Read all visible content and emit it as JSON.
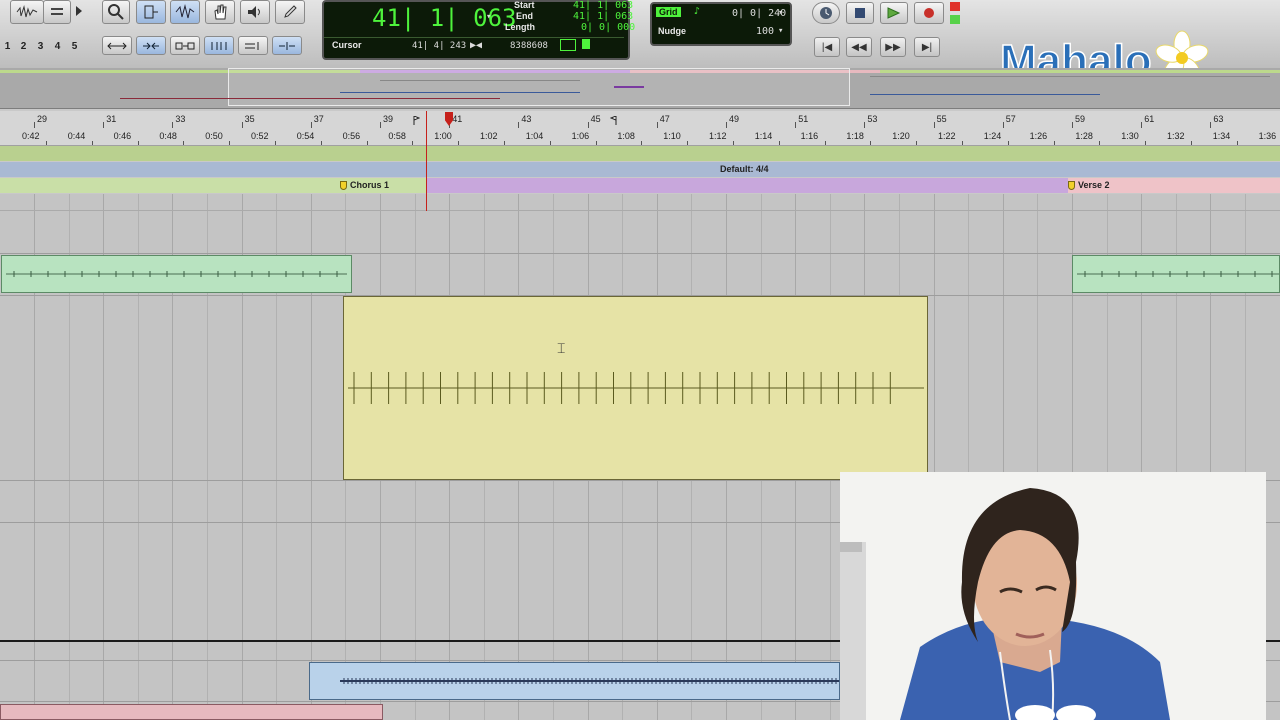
{
  "toolbar": {
    "zoom_presets": [
      "1",
      "2",
      "3",
      "4",
      "5"
    ],
    "counter": {
      "main": "41| 1| 063",
      "start_label": "Start",
      "start": "41| 1| 063",
      "end_label": "End",
      "end": "41| 1| 063",
      "length_label": "Length",
      "length": "0| 0| 000",
      "cursor_label": "Cursor",
      "cursor": "41| 4| 243",
      "samples": "8388608"
    },
    "grid": {
      "grid_label": "Grid",
      "grid_value": "0| 0| 240",
      "nudge_label": "Nudge",
      "nudge_value": "100"
    }
  },
  "rulers": {
    "bars": [
      "29",
      "31",
      "33",
      "35",
      "37",
      "39",
      "41",
      "43",
      "45",
      "47",
      "49",
      "51",
      "53",
      "55",
      "57",
      "59",
      "61",
      "63"
    ],
    "minsecs": [
      "0:42",
      "0:44",
      "0:46",
      "0:48",
      "0:50",
      "0:52",
      "0:54",
      "0:56",
      "0:58",
      "1:00",
      "1:02",
      "1:04",
      "1:06",
      "1:08",
      "1:10",
      "1:12",
      "1:14",
      "1:16",
      "1:18",
      "1:20",
      "1:22",
      "1:24",
      "1:26",
      "1:28",
      "1:30",
      "1:32",
      "1:34",
      "1:36"
    ],
    "meter": "Default: 4/4",
    "markers": [
      {
        "label": "Chorus 1"
      },
      {
        "label": "Verse 2"
      }
    ]
  },
  "watermark": "Mahalo",
  "colors": {
    "counter_text": "#4ef33c",
    "tempo_ruler": "#b9d08f",
    "meter_ruler": "#a9b9d3",
    "marker_ruler": "#c8a7dc",
    "clip_green": "#b8e3c0",
    "clip_yellow": "#e6e3a6",
    "clip_blue": "#b9d2ea",
    "clip_pink": "#e7b9bf",
    "playhead": "#c6211b",
    "logo_blue": "#2a6fb8"
  }
}
